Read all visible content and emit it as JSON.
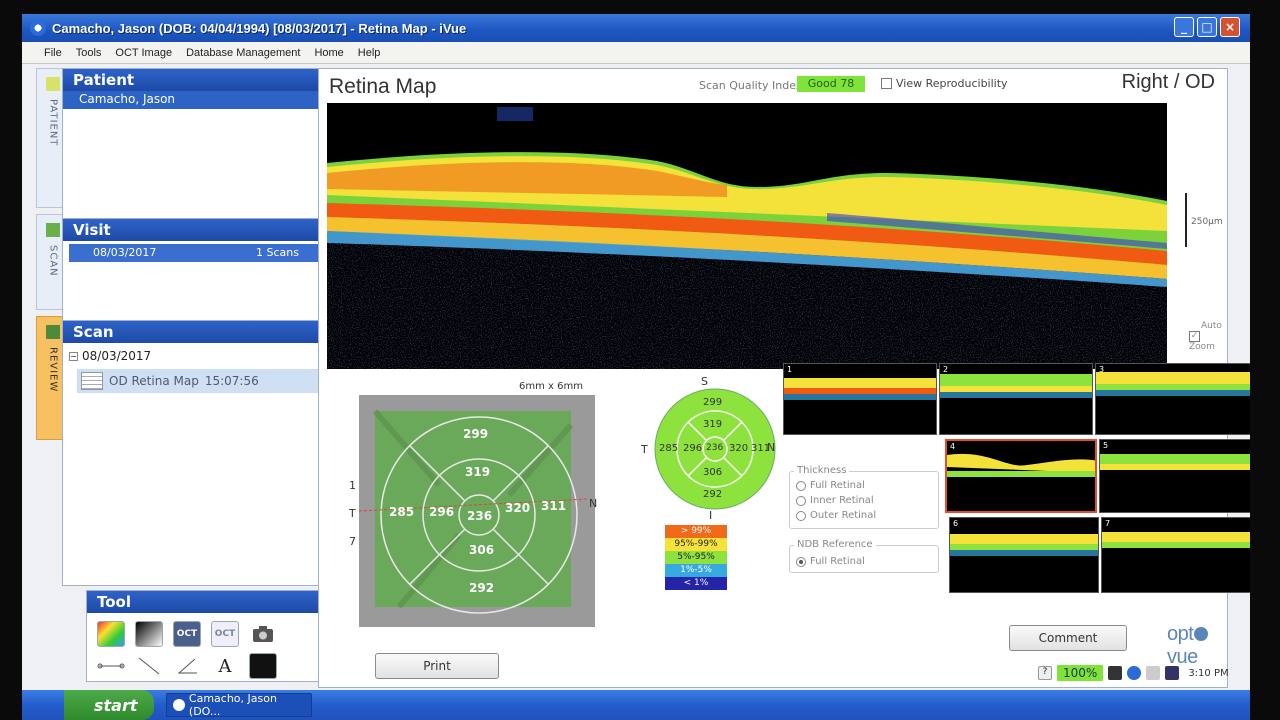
{
  "window": {
    "title": "Camacho, Jason  (DOB: 04/04/1994)  [08/03/2017] - Retina Map - iVue"
  },
  "menu": [
    "File",
    "Tools",
    "OCT Image",
    "Database Management",
    "Home",
    "Help"
  ],
  "vtabs": [
    "PATIENT",
    "SCAN",
    "REVIEW"
  ],
  "patient": {
    "header": "Patient",
    "selected": "Camacho, Jason"
  },
  "visit": {
    "header": "Visit",
    "date": "08/03/2017",
    "scans": "1 Scans"
  },
  "scan": {
    "header": "Scan",
    "date": "08/03/2017",
    "item_name": "OD Retina Map",
    "item_time": "15:07:56"
  },
  "tool": {
    "header": "Tool",
    "oct1": "OCT",
    "oct2": "OCT",
    "text_tool": "A"
  },
  "main": {
    "title": "Retina Map",
    "sqi_label": "Scan Quality Index",
    "sqi_value": "Good  78",
    "reproducibility": "View Reproducibility",
    "eye": "Right / OD",
    "scale": "250µm",
    "auto_zoom_1": "Auto",
    "auto_zoom_2": "Zoom"
  },
  "fundus": {
    "size_label": "6mm x 6mm",
    "temporal": "T",
    "nasal": "N",
    "tick_top": "1",
    "tick_bottom": "7",
    "values": {
      "outer_sup": "299",
      "inner_sup": "319",
      "outer_temp": "285",
      "inner_temp": "296",
      "center": "236",
      "inner_nasal": "320",
      "outer_nasal": "311",
      "inner_inf": "306",
      "outer_inf": "292"
    }
  },
  "etdrs": {
    "sup": "S",
    "inf": "I",
    "temporal": "T",
    "nasal": "N",
    "values": {
      "outer_sup": "299",
      "inner_sup": "319",
      "outer_temp": "285",
      "inner_temp": "296",
      "center": "236",
      "inner_nasal": "320",
      "outer_nasal": "311",
      "inner_inf": "306",
      "outer_inf": "292"
    }
  },
  "legend": [
    {
      "label": "> 99%",
      "color": "#f06a1a"
    },
    {
      "label": "95%-99%",
      "color": "#f7e23a"
    },
    {
      "label": "5%-95%",
      "color": "#8ee23d"
    },
    {
      "label": "1%-5%",
      "color": "#37a8e0"
    },
    {
      "label": "< 1%",
      "color": "#2424a8"
    }
  ],
  "thumbnails": [
    "1",
    "2",
    "3",
    "4",
    "5",
    "6",
    "7"
  ],
  "thickness": {
    "legend": "Thickness",
    "options": [
      "Full Retinal",
      "Inner Retinal",
      "Outer Retinal"
    ]
  },
  "ndb": {
    "legend": "NDB Reference",
    "option": "Full Retinal"
  },
  "buttons": {
    "print": "Print",
    "comment": "Comment"
  },
  "logo": {
    "pre": "opt",
    "post": "vue"
  },
  "tray": {
    "zoom": "100%",
    "time": "3:10 PM"
  },
  "taskbar": {
    "start": "start",
    "task": "Camacho, Jason (DO..."
  },
  "colors": {
    "sqi": "#7ee43a",
    "accent": "#2e63c6",
    "map_green": "#8ee23d"
  }
}
